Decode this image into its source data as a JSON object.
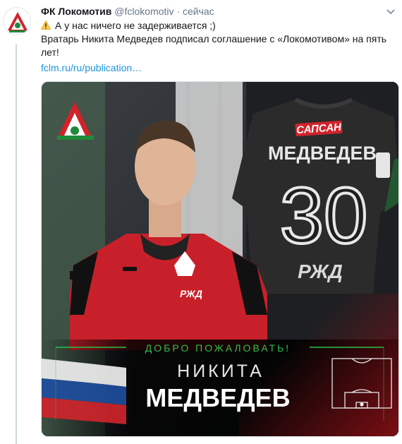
{
  "tweet": {
    "author_name": "ФК Локомотив",
    "handle": "@fclokomotiv",
    "separator": "·",
    "time": "сейчас",
    "line1": "А у нас ничего не задерживается ;)",
    "line2": "Вратарь Никита Медведев подписал соглашение с «Локомотивом» на пять лет!",
    "link": "fclm.ru/ru/publication…"
  },
  "image": {
    "sponsor_patch": "САПСАН",
    "shirt_name": "МЕДВЕДЕВ",
    "shirt_number": "30",
    "shirt_sponsor": "РЖД",
    "chest_sponsor": "РЖД",
    "welcome": "ДОБРО ПОЖАЛОВАТЬ!",
    "first_name": "НИКИТА",
    "last_name": "МЕДВЕДЕВ"
  },
  "colors": {
    "accent_green": "#2fbf4a",
    "club_red": "#d0232a",
    "link_blue": "#1b95e0"
  }
}
